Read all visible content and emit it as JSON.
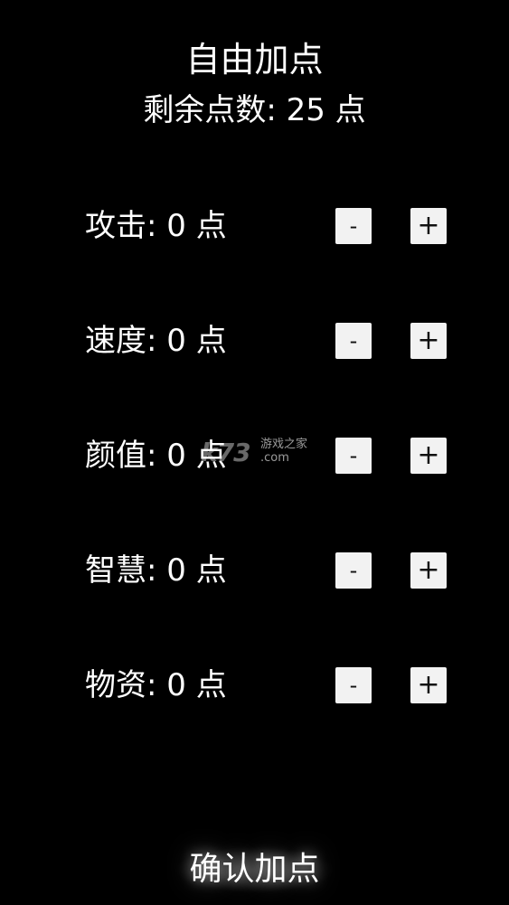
{
  "header": {
    "title": "自由加点",
    "remaining": "剩余点数: 25 点"
  },
  "stats": [
    {
      "label": "攻击: 0 点",
      "minus": "-",
      "plus": "+"
    },
    {
      "label": "速度: 0 点",
      "minus": "-",
      "plus": "+"
    },
    {
      "label": "颜值: 0 点",
      "minus": "-",
      "plus": "+"
    },
    {
      "label": "智慧: 0 点",
      "minus": "-",
      "plus": "+"
    },
    {
      "label": "物资: 0 点",
      "minus": "-",
      "plus": "+"
    }
  ],
  "watermark": {
    "logo": "k73",
    "text": "游戏之家",
    "domain": ".com"
  },
  "footer": {
    "confirm_label": "确认加点"
  },
  "colors": {
    "background": "#000000",
    "text": "#ffffff",
    "button_bg": "#f2f2f2",
    "button_text": "#111111"
  }
}
